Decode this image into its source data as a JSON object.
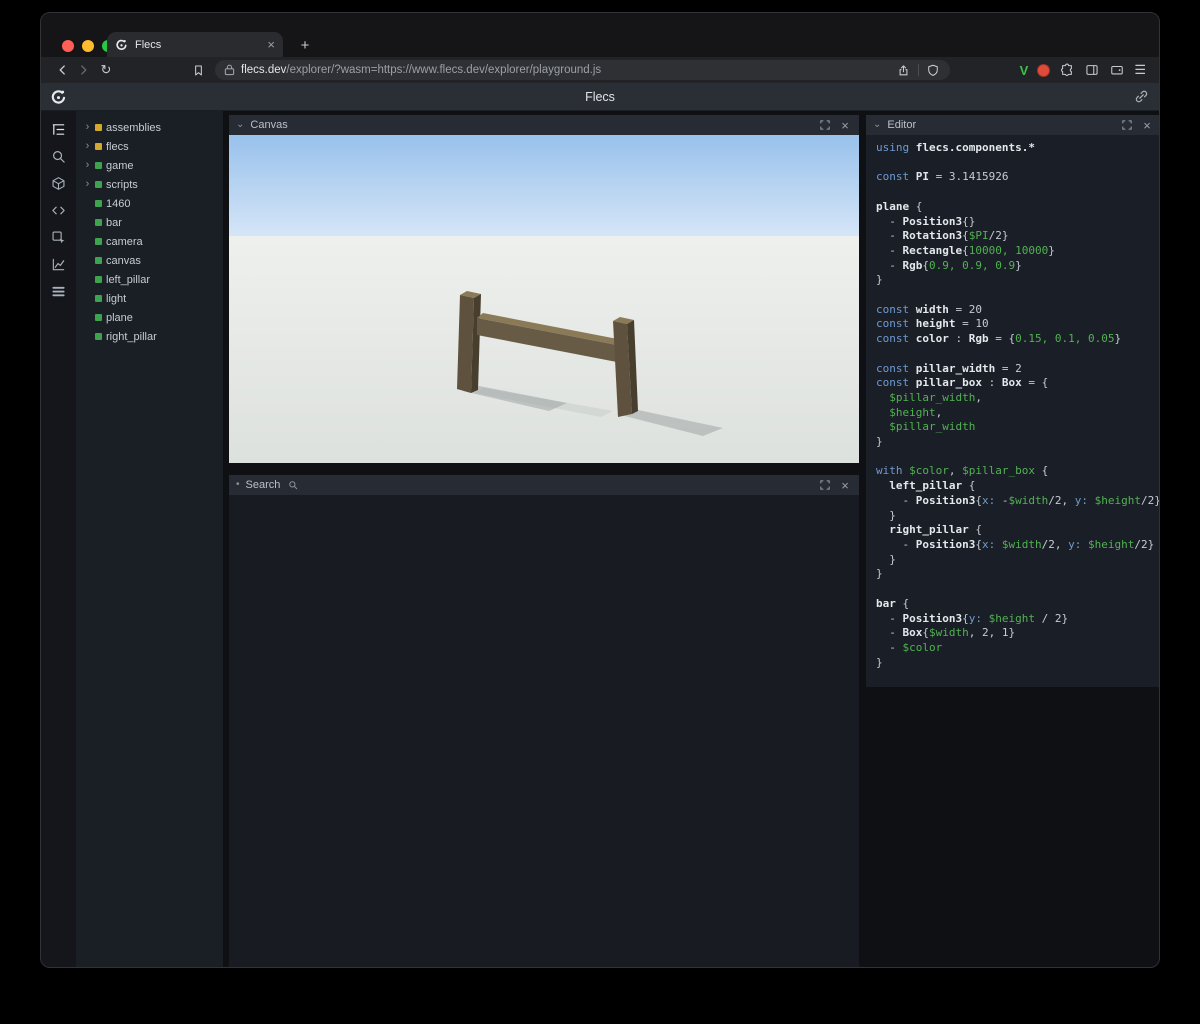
{
  "browser": {
    "tab_title": "Flecs",
    "url_domain": "flecs.dev",
    "url_path": "/explorer/?wasm=https://www.flecs.dev/explorer/playground.js"
  },
  "header": {
    "title": "Flecs"
  },
  "icons": {
    "new_tab": "+",
    "close_tab": "×",
    "close_panel": "×",
    "reload": "↻",
    "menu": "☰",
    "tree_collapsed": "›",
    "canvas_marker": "⌄",
    "search_marker": "•",
    "editor_marker": "⌄",
    "extension_v": "V"
  },
  "panels": {
    "canvas": {
      "title": "Canvas"
    },
    "search": {
      "title": "Search"
    },
    "editor": {
      "title": "Editor"
    }
  },
  "sidebar": {
    "tree_items": [
      {
        "label": "assemblies",
        "expandable": true,
        "dot_color": "#d2a92c"
      },
      {
        "label": "flecs",
        "expandable": true,
        "dot_color": "#d2a92c"
      },
      {
        "label": "game",
        "expandable": true,
        "dot_color": "#3fa24e"
      },
      {
        "label": "scripts",
        "expandable": true,
        "dot_color": "#3fa24e"
      },
      {
        "label": "1460",
        "expandable": false,
        "dot_color": "#3fa24e"
      },
      {
        "label": "bar",
        "expandable": false,
        "dot_color": "#3fa24e"
      },
      {
        "label": "camera",
        "expandable": false,
        "dot_color": "#3fa24e"
      },
      {
        "label": "canvas",
        "expandable": false,
        "dot_color": "#3fa24e"
      },
      {
        "label": "left_pillar",
        "expandable": false,
        "dot_color": "#3fa24e"
      },
      {
        "label": "light",
        "expandable": false,
        "dot_color": "#3fa24e"
      },
      {
        "label": "plane",
        "expandable": false,
        "dot_color": "#3fa24e"
      },
      {
        "label": "right_pillar",
        "expandable": false,
        "dot_color": "#3fa24e"
      }
    ]
  },
  "scene": {
    "sky_top": "#98c1ec",
    "sky_bottom": "#d6e6f7",
    "ground_far": "#eef0ed",
    "ground_near": "#dde1dd",
    "wood_top": "#8a7a58",
    "wood_front": "#5e523f",
    "wood_side": "#483e2e",
    "bar_front": "#675b46",
    "shadow": "#9aa0a2"
  },
  "colors": {
    "entity_yellow": "#d2a92c",
    "entity_green": "#3fa24e",
    "syntax_keyword": "#6f9ad1",
    "syntax_identifier": "#e4e8ec",
    "syntax_variable": "#52b152",
    "traffic_red": "#ff5f57",
    "traffic_yellow": "#febc2e",
    "traffic_green": "#28c840"
  },
  "editor": {
    "code_lines": [
      [
        {
          "t": "using",
          "c": "k"
        },
        {
          "t": " "
        },
        {
          "t": "flecs.components.*",
          "c": "i"
        }
      ],
      [],
      [
        {
          "t": "const",
          "c": "k"
        },
        {
          "t": " "
        },
        {
          "t": "PI",
          "c": "i"
        },
        {
          "t": " = 3.1415926"
        }
      ],
      [],
      [
        {
          "t": "plane",
          "c": "i"
        },
        {
          "t": " {"
        }
      ],
      [
        {
          "t": "  - "
        },
        {
          "t": "Position3",
          "c": "i"
        },
        {
          "t": "{}"
        }
      ],
      [
        {
          "t": "  - "
        },
        {
          "t": "Rotation3",
          "c": "i"
        },
        {
          "t": "{"
        },
        {
          "t": "$PI",
          "c": "v"
        },
        {
          "t": "/2}"
        }
      ],
      [
        {
          "t": "  - "
        },
        {
          "t": "Rectangle",
          "c": "i"
        },
        {
          "t": "{"
        },
        {
          "t": "10000, 10000",
          "c": "n"
        },
        {
          "t": "}"
        }
      ],
      [
        {
          "t": "  - "
        },
        {
          "t": "Rgb",
          "c": "i"
        },
        {
          "t": "{"
        },
        {
          "t": "0.9, 0.9, 0.9",
          "c": "n"
        },
        {
          "t": "}"
        }
      ],
      [
        {
          "t": "}"
        }
      ],
      [],
      [
        {
          "t": "const",
          "c": "k"
        },
        {
          "t": " "
        },
        {
          "t": "width",
          "c": "i"
        },
        {
          "t": " = 20"
        }
      ],
      [
        {
          "t": "const",
          "c": "k"
        },
        {
          "t": " "
        },
        {
          "t": "height",
          "c": "i"
        },
        {
          "t": " = 10"
        }
      ],
      [
        {
          "t": "const",
          "c": "k"
        },
        {
          "t": " "
        },
        {
          "t": "color",
          "c": "i"
        },
        {
          "t": " : "
        },
        {
          "t": "Rgb",
          "c": "i"
        },
        {
          "t": " = {"
        },
        {
          "t": "0.15, 0.1, 0.05",
          "c": "n"
        },
        {
          "t": "}"
        }
      ],
      [],
      [
        {
          "t": "const",
          "c": "k"
        },
        {
          "t": " "
        },
        {
          "t": "pillar_width",
          "c": "i"
        },
        {
          "t": " = 2"
        }
      ],
      [
        {
          "t": "const",
          "c": "k"
        },
        {
          "t": " "
        },
        {
          "t": "pillar_box",
          "c": "i"
        },
        {
          "t": " : "
        },
        {
          "t": "Box",
          "c": "i"
        },
        {
          "t": " = {"
        }
      ],
      [
        {
          "t": "  "
        },
        {
          "t": "$pillar_width",
          "c": "v"
        },
        {
          "t": ","
        }
      ],
      [
        {
          "t": "  "
        },
        {
          "t": "$height",
          "c": "v"
        },
        {
          "t": ","
        }
      ],
      [
        {
          "t": "  "
        },
        {
          "t": "$pillar_width",
          "c": "v"
        }
      ],
      [
        {
          "t": "}"
        }
      ],
      [],
      [
        {
          "t": "with",
          "c": "k"
        },
        {
          "t": " "
        },
        {
          "t": "$color",
          "c": "v"
        },
        {
          "t": ", "
        },
        {
          "t": "$pillar_box",
          "c": "v"
        },
        {
          "t": " {"
        }
      ],
      [
        {
          "t": "  "
        },
        {
          "t": "left_pillar",
          "c": "i"
        },
        {
          "t": " {"
        }
      ],
      [
        {
          "t": "    - "
        },
        {
          "t": "Position3",
          "c": "i"
        },
        {
          "t": "{"
        },
        {
          "t": "x:",
          "c": "k"
        },
        {
          "t": " -"
        },
        {
          "t": "$width",
          "c": "v"
        },
        {
          "t": "/2, "
        },
        {
          "t": "y:",
          "c": "k"
        },
        {
          "t": " "
        },
        {
          "t": "$height",
          "c": "v"
        },
        {
          "t": "/2}"
        }
      ],
      [
        {
          "t": "  }"
        }
      ],
      [
        {
          "t": "  "
        },
        {
          "t": "right_pillar",
          "c": "i"
        },
        {
          "t": " {"
        }
      ],
      [
        {
          "t": "    - "
        },
        {
          "t": "Position3",
          "c": "i"
        },
        {
          "t": "{"
        },
        {
          "t": "x:",
          "c": "k"
        },
        {
          "t": " "
        },
        {
          "t": "$width",
          "c": "v"
        },
        {
          "t": "/2, "
        },
        {
          "t": "y:",
          "c": "k"
        },
        {
          "t": " "
        },
        {
          "t": "$height",
          "c": "v"
        },
        {
          "t": "/2}"
        }
      ],
      [
        {
          "t": "  }"
        }
      ],
      [
        {
          "t": "}"
        }
      ],
      [],
      [
        {
          "t": "bar",
          "c": "i"
        },
        {
          "t": " {"
        }
      ],
      [
        {
          "t": "  - "
        },
        {
          "t": "Position3",
          "c": "i"
        },
        {
          "t": "{"
        },
        {
          "t": "y:",
          "c": "k"
        },
        {
          "t": " "
        },
        {
          "t": "$height",
          "c": "v"
        },
        {
          "t": " / 2}"
        }
      ],
      [
        {
          "t": "  - "
        },
        {
          "t": "Box",
          "c": "i"
        },
        {
          "t": "{"
        },
        {
          "t": "$width",
          "c": "v"
        },
        {
          "t": ", 2, 1}"
        }
      ],
      [
        {
          "t": "  - "
        },
        {
          "t": "$color",
          "c": "v"
        }
      ],
      [
        {
          "t": "}"
        }
      ]
    ]
  }
}
